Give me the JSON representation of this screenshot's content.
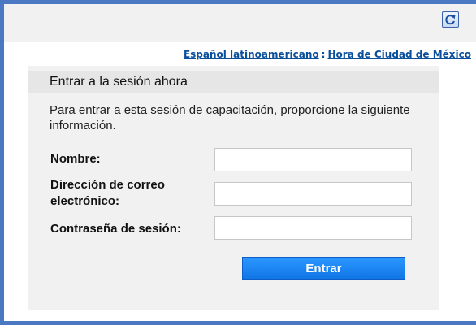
{
  "header": {
    "refresh_icon": "refresh-icon"
  },
  "locale_links": {
    "language": "Español latinoamericano",
    "separator": ":",
    "timezone": "Hora de Ciudad de México"
  },
  "session_panel": {
    "title": "Entrar a la sesión ahora",
    "intro": "Para entrar a esta sesión de capacitación, proporcione la siguiente información.",
    "fields": [
      {
        "label": "Nombre:",
        "value": "",
        "placeholder": ""
      },
      {
        "label": "Dirección de correo electrónico:",
        "value": "",
        "placeholder": ""
      },
      {
        "label": "Contraseña de sesión:",
        "value": "",
        "placeholder": ""
      }
    ],
    "submit_label": "Entrar"
  },
  "colors": {
    "frame_border": "#4a78c2",
    "link": "#0a4f9c",
    "button": "#1a86f5"
  }
}
